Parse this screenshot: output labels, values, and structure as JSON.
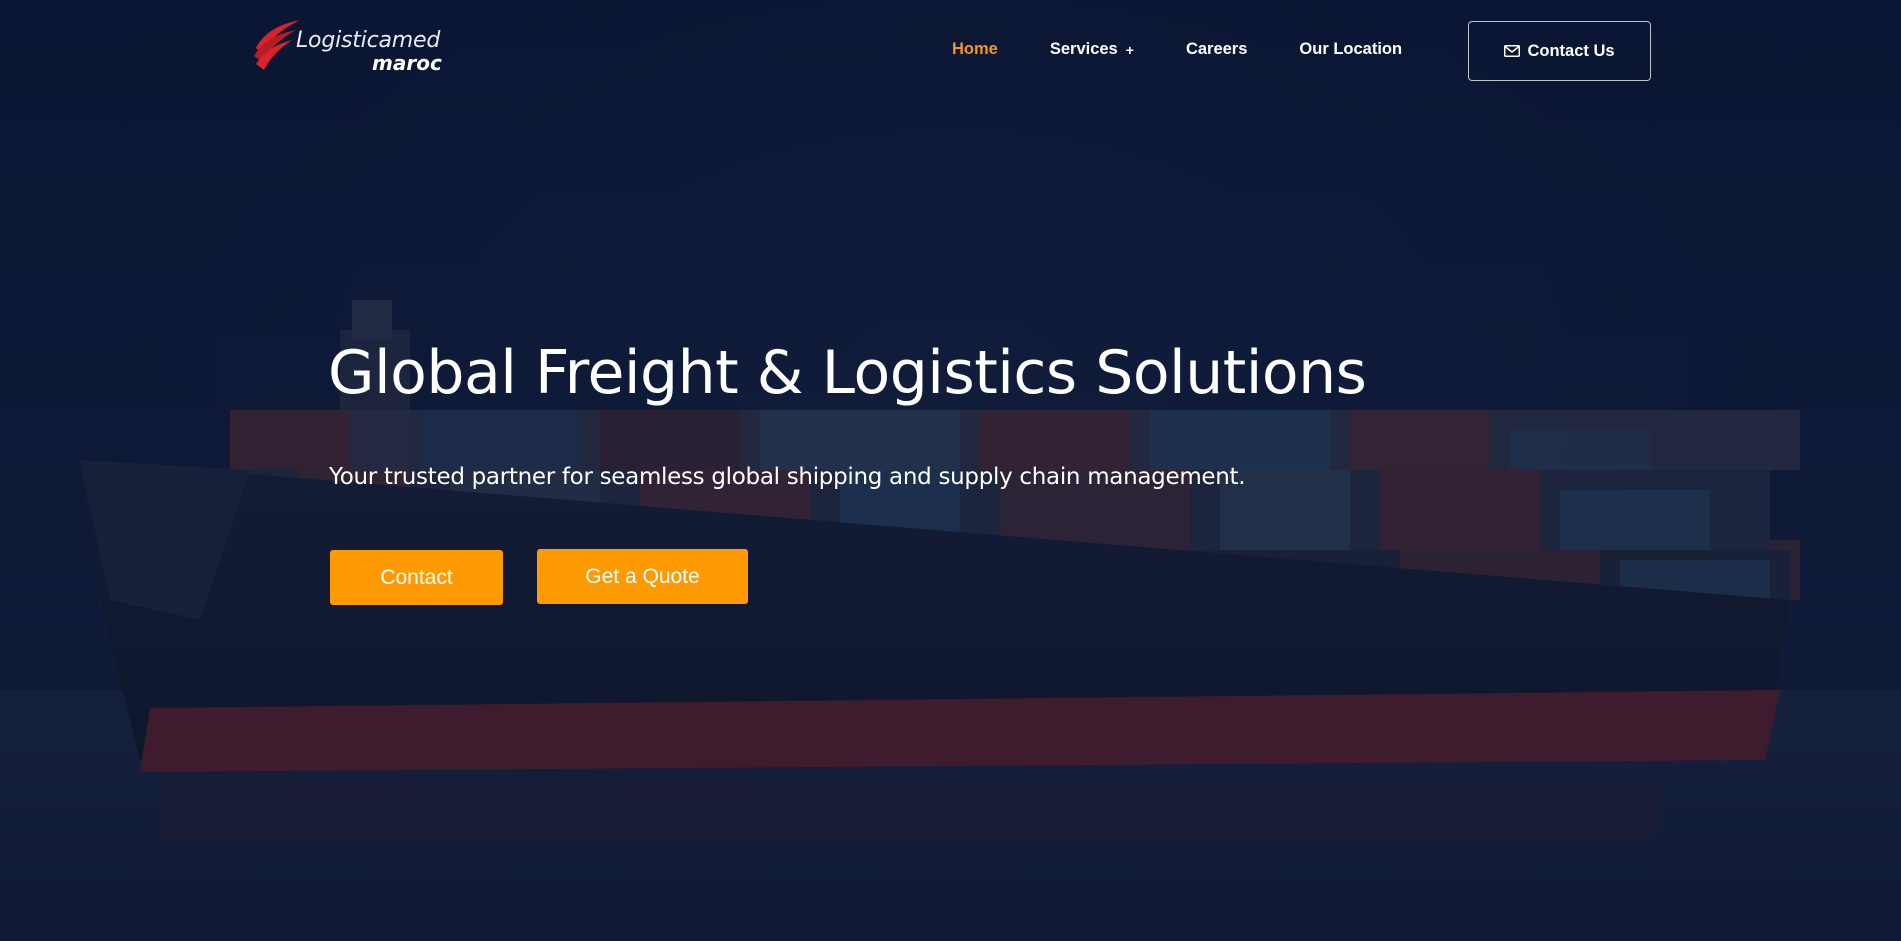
{
  "brand": {
    "name_line1": "Logisticamed",
    "name_line2": "maroc",
    "accent_color": "#f7941d",
    "logo_color": "#d8232a"
  },
  "nav": {
    "items": [
      {
        "label": "Home",
        "active": true
      },
      {
        "label": "Services",
        "has_submenu": true,
        "submenu_icon": "+"
      },
      {
        "label": "Careers"
      },
      {
        "label": "Our Location"
      }
    ],
    "contact_button": {
      "label": "Contact Us",
      "icon": "envelope-icon"
    }
  },
  "hero": {
    "headline": "Global Freight & Logistics Solutions",
    "subheadline": "Your trusted partner for seamless global shipping and supply chain management.",
    "buttons": {
      "primary": "Contact",
      "secondary": "Get a Quote"
    },
    "button_color": "#ff9a02",
    "background_image": "container-ship"
  }
}
